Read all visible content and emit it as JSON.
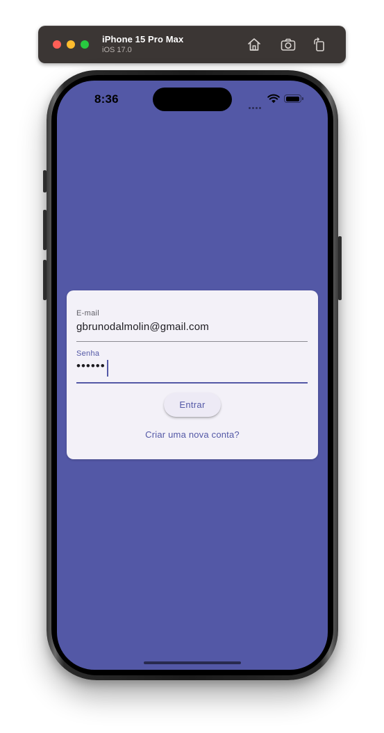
{
  "simulator": {
    "device_name": "iPhone 15 Pro Max",
    "os_version": "iOS 17.0",
    "buttons": {
      "home_icon": "home-icon",
      "screenshot_icon": "camera-icon",
      "rotate_icon": "rotate-icon"
    }
  },
  "status_bar": {
    "time": "8:36",
    "battery_level": 1.0
  },
  "login": {
    "email_label": "E-mail",
    "email_value": "gbrunodalmolin@gmail.com",
    "password_label": "Senha",
    "password_value": "••••••",
    "submit_label": "Entrar",
    "create_account_label": "Criar uma nova conta?"
  },
  "colors": {
    "background": "#5358a6",
    "card": "#f3f1f8",
    "accent": "#5358a6"
  }
}
